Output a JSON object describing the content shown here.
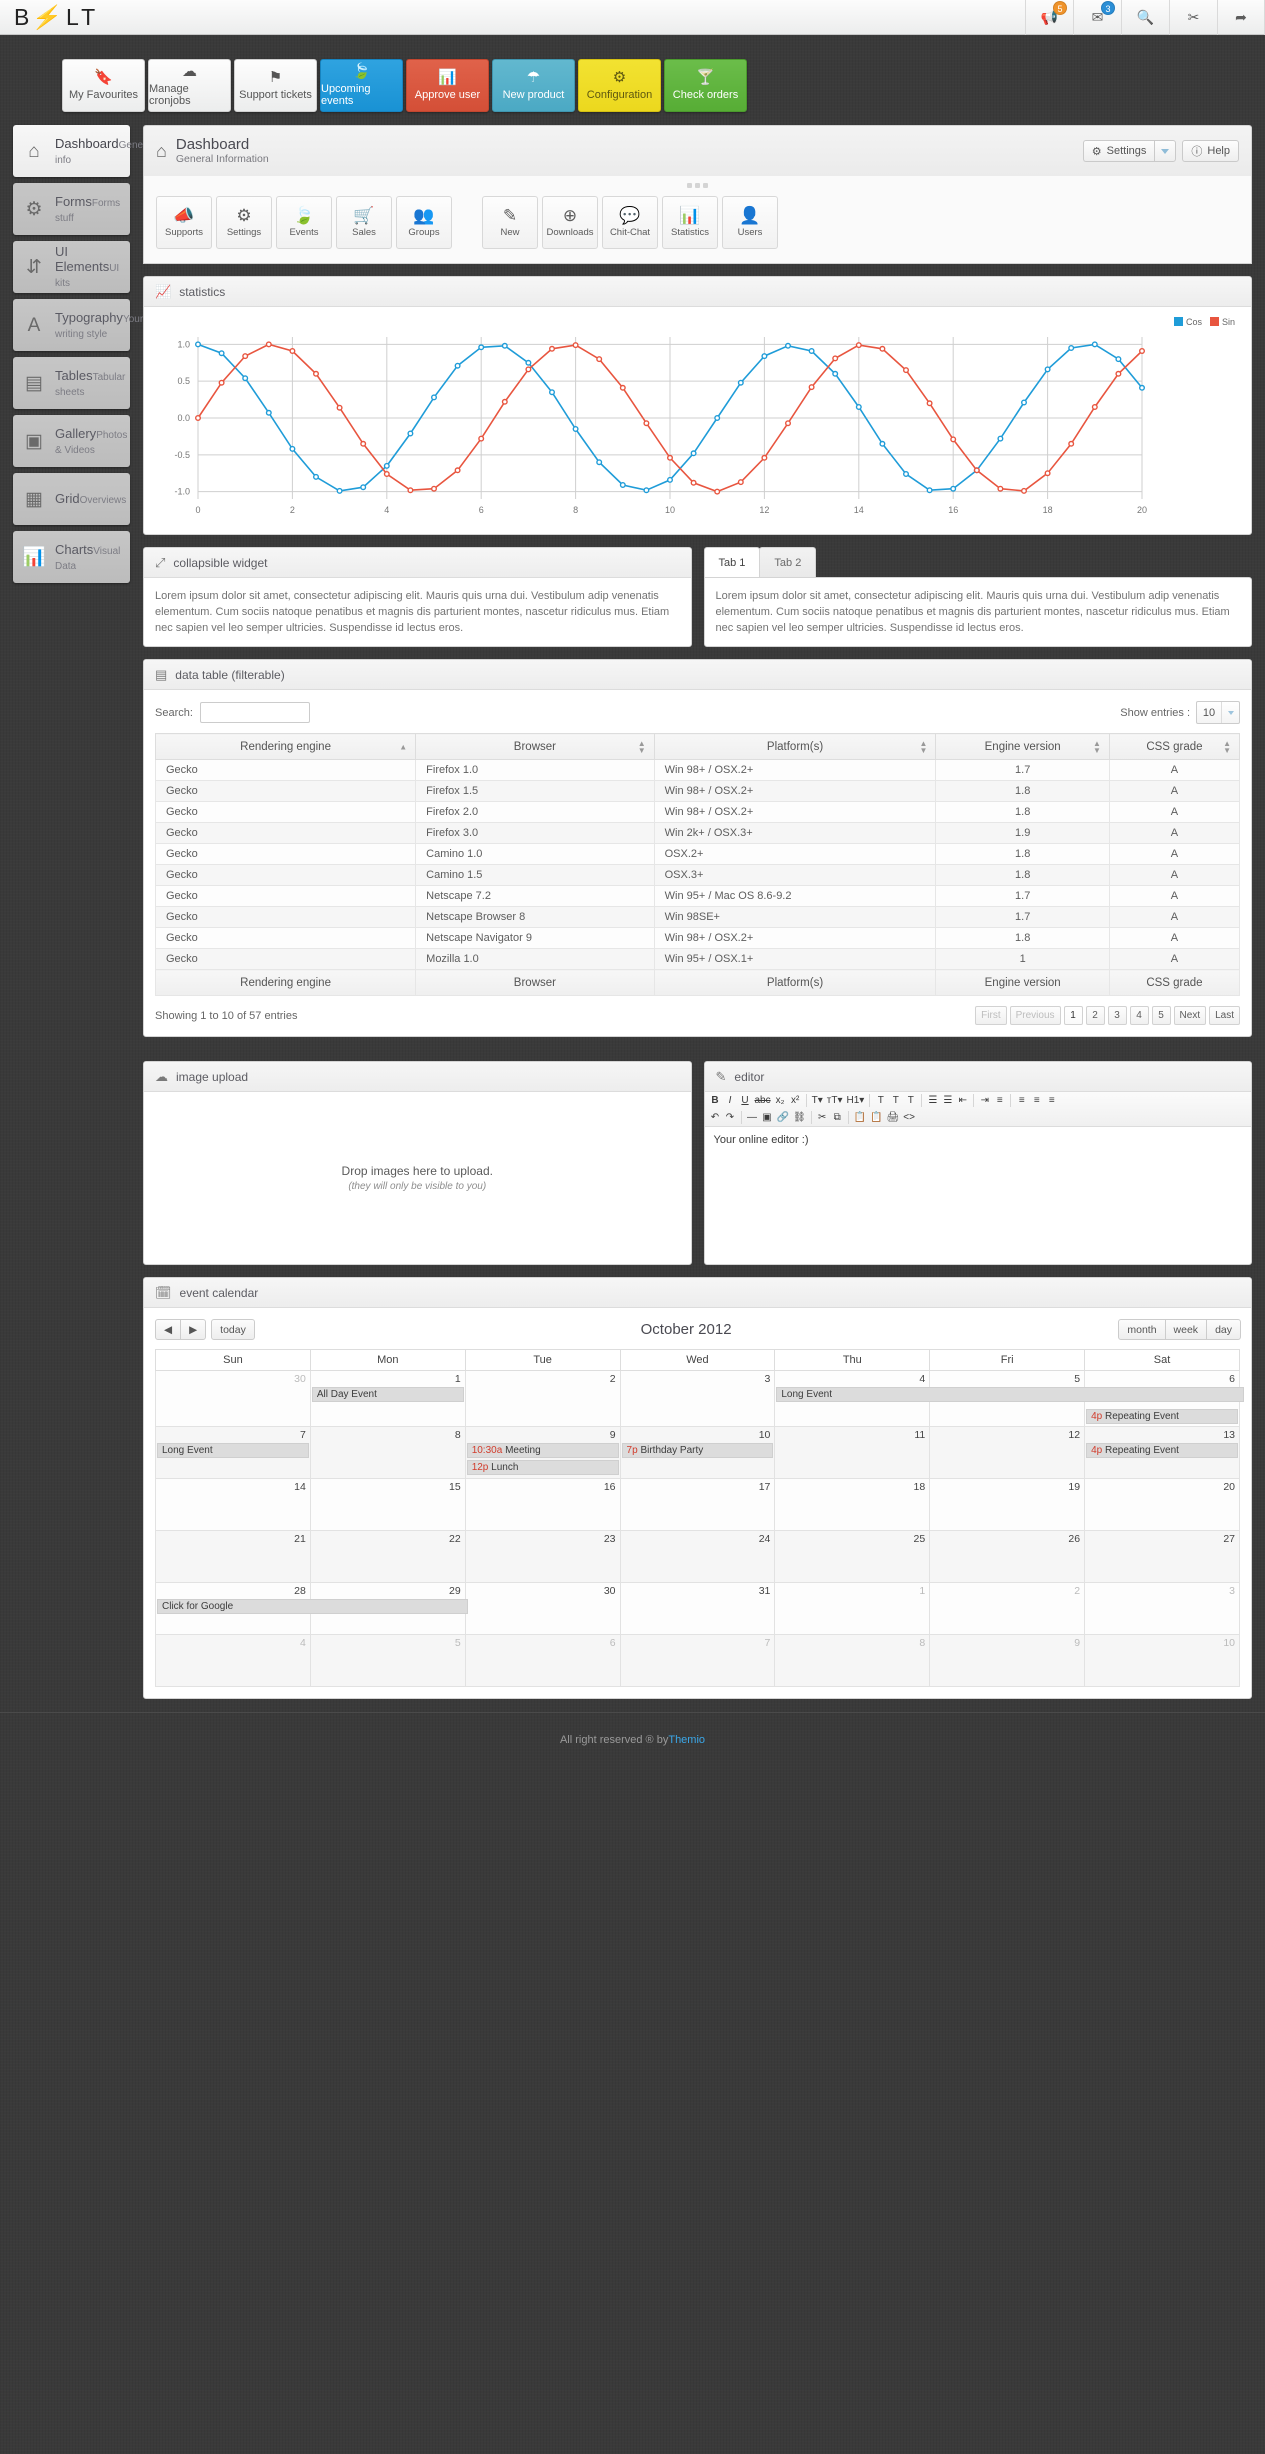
{
  "brand": {
    "before": "B",
    "bolt": "⚡",
    "after": "LT"
  },
  "topbar": {
    "icons": [
      {
        "name": "megaphone-icon",
        "glyph": "📢",
        "badge": "5",
        "badge_color": "#f0932a"
      },
      {
        "name": "envelope-icon",
        "glyph": "✉",
        "badge": "3",
        "badge_color": "#2a8ed6"
      },
      {
        "name": "search-icon",
        "glyph": "🔍",
        "badge": ""
      },
      {
        "name": "tools-icon",
        "glyph": "✂",
        "badge": ""
      },
      {
        "name": "share-icon",
        "glyph": "➦",
        "badge": ""
      }
    ]
  },
  "tiles": [
    {
      "label": "My Favourites",
      "icon": "bookmark-icon",
      "glyph": "🔖",
      "style": ""
    },
    {
      "label": "Manage cronjobs",
      "icon": "cloud-icon",
      "glyph": "☁",
      "style": ""
    },
    {
      "label": "Support tickets",
      "icon": "flag-icon",
      "glyph": "⚑",
      "style": ""
    },
    {
      "label": "Upcoming events",
      "icon": "leaf-icon",
      "glyph": "🍃",
      "style": "blue"
    },
    {
      "label": "Approve user",
      "icon": "chart-icon",
      "glyph": "📊",
      "style": "red"
    },
    {
      "label": "New product",
      "icon": "umbrella-icon",
      "glyph": "☂",
      "style": "teal"
    },
    {
      "label": "Configuration",
      "icon": "gears-icon",
      "glyph": "⚙",
      "style": "yellow"
    },
    {
      "label": "Check orders",
      "icon": "cocktail-icon",
      "glyph": "🍸",
      "style": "green"
    }
  ],
  "sidebar": {
    "items": [
      {
        "title": "Dashboard",
        "sub": "General info",
        "icon": "home-icon",
        "glyph": "⌂",
        "active": true
      },
      {
        "title": "Forms",
        "sub": "Forms stuff",
        "icon": "gear-icon",
        "glyph": "⚙",
        "active": false
      },
      {
        "title": "UI Elements",
        "sub": "UI kits",
        "icon": "sliders-icon",
        "glyph": "⇵",
        "active": false
      },
      {
        "title": "Typography",
        "sub": "Your writing style",
        "icon": "font-icon",
        "glyph": "A",
        "active": false
      },
      {
        "title": "Tables",
        "sub": "Tabular sheets",
        "icon": "table-icon",
        "glyph": "▤",
        "active": false
      },
      {
        "title": "Gallery",
        "sub": "Photos & Videos",
        "icon": "image-icon",
        "glyph": "▣",
        "active": false
      },
      {
        "title": "Grid",
        "sub": "Overviews",
        "icon": "grid-icon",
        "glyph": "▦",
        "active": false
      },
      {
        "title": "Charts",
        "sub": "Visual Data",
        "icon": "bar-chart-icon",
        "glyph": "📊",
        "active": false
      }
    ]
  },
  "page": {
    "title": "Dashboard",
    "subtitle": "General Information",
    "settings_label": "Settings",
    "help_label": "Help"
  },
  "shortcuts": [
    {
      "label": "Supports",
      "icon": "megaphone-icon",
      "glyph": "📣"
    },
    {
      "label": "Settings",
      "icon": "gear-icon",
      "glyph": "⚙"
    },
    {
      "label": "Events",
      "icon": "leaf-icon",
      "glyph": "🍃"
    },
    {
      "label": "Sales",
      "icon": "cart-icon",
      "glyph": "🛒"
    },
    {
      "label": "Groups",
      "icon": "group-icon",
      "glyph": "👥"
    },
    {
      "label": "New",
      "icon": "edit-icon",
      "glyph": "✎"
    },
    {
      "label": "Downloads",
      "icon": "download-icon",
      "glyph": "⊕"
    },
    {
      "label": "Chit-Chat",
      "icon": "comments-icon",
      "glyph": "💬"
    },
    {
      "label": "Statistics",
      "icon": "bar-chart-icon",
      "glyph": "📊"
    },
    {
      "label": "Users",
      "icon": "user-icon",
      "glyph": "👤"
    }
  ],
  "statistics": {
    "title": "statistics"
  },
  "chart_data": {
    "type": "line",
    "title": "statistics",
    "xlabel": "",
    "ylabel": "",
    "xlim": [
      0,
      20
    ],
    "ylim": [
      -1.1,
      1.1
    ],
    "xticks": [
      0,
      2,
      4,
      6,
      8,
      10,
      12,
      14,
      16,
      18,
      20
    ],
    "yticks": [
      -1.0,
      -0.5,
      0.0,
      0.5,
      1.0
    ],
    "grid": true,
    "legend_position": "top-right",
    "x": [
      0,
      0.5,
      1,
      1.5,
      2,
      2.5,
      3,
      3.5,
      4,
      4.5,
      5,
      5.5,
      6,
      6.5,
      7,
      7.5,
      8,
      8.5,
      9,
      9.5,
      10,
      10.5,
      11,
      11.5,
      12,
      12.5,
      13,
      13.5,
      14,
      14.5,
      15,
      15.5,
      16,
      16.5,
      17,
      17.5,
      18,
      18.5,
      19,
      19.5,
      20
    ],
    "series": [
      {
        "name": "Cos",
        "color": "#1f9cd8",
        "values": [
          1.0,
          0.88,
          0.54,
          0.07,
          -0.42,
          -0.8,
          -0.99,
          -0.94,
          -0.65,
          -0.21,
          0.28,
          0.71,
          0.96,
          0.98,
          0.75,
          0.35,
          -0.15,
          -0.6,
          -0.91,
          -0.98,
          -0.84,
          -0.48,
          0.0,
          0.48,
          0.84,
          0.98,
          0.91,
          0.6,
          0.15,
          -0.35,
          -0.76,
          -0.98,
          -0.96,
          -0.71,
          -0.28,
          0.21,
          0.66,
          0.95,
          1.0,
          0.8,
          0.41
        ]
      },
      {
        "name": "Sin",
        "color": "#e8553f",
        "values": [
          0.0,
          0.48,
          0.84,
          1.0,
          0.91,
          0.6,
          0.14,
          -0.35,
          -0.76,
          -0.98,
          -0.96,
          -0.71,
          -0.28,
          0.22,
          0.66,
          0.94,
          0.99,
          0.8,
          0.41,
          -0.07,
          -0.54,
          -0.88,
          -1.0,
          -0.87,
          -0.54,
          -0.07,
          0.42,
          0.81,
          0.99,
          0.94,
          0.65,
          0.2,
          -0.29,
          -0.71,
          -0.96,
          -0.99,
          -0.75,
          -0.35,
          0.15,
          0.6,
          0.91
        ]
      }
    ]
  },
  "collapsible": {
    "title": "collapsible widget",
    "body": "Lorem ipsum dolor sit amet, consectetur adipiscing elit. Mauris quis urna dui. Vestibulum adip venenatis elementum. Cum sociis natoque penatibus et magnis dis parturient montes, nascetur ridiculus mus. Etiam nec sapien vel leo semper ultricies. Suspendisse id lectus eros."
  },
  "tabs": {
    "items": [
      {
        "label": "Tab 1",
        "active": true
      },
      {
        "label": "Tab 2",
        "active": false
      }
    ],
    "body": "Lorem ipsum dolor sit amet, consectetur adipiscing elit. Mauris quis urna dui. Vestibulum adip venenatis elementum. Cum sociis natoque penatibus et magnis dis parturient montes, nascetur ridiculus mus. Etiam nec sapien vel leo semper ultricies. Suspendisse id lectus eros."
  },
  "datatable": {
    "title": "data table (filterable)",
    "search_label": "Search:",
    "search_value": "",
    "show_entries_label": "Show entries :",
    "entries_value": "10",
    "columns": [
      "Rendering engine",
      "Browser",
      "Platform(s)",
      "Engine version",
      "CSS grade"
    ],
    "rows": [
      [
        "Gecko",
        "Firefox 1.0",
        "Win 98+ / OSX.2+",
        "1.7",
        "A"
      ],
      [
        "Gecko",
        "Firefox 1.5",
        "Win 98+ / OSX.2+",
        "1.8",
        "A"
      ],
      [
        "Gecko",
        "Firefox 2.0",
        "Win 98+ / OSX.2+",
        "1.8",
        "A"
      ],
      [
        "Gecko",
        "Firefox 3.0",
        "Win 2k+ / OSX.3+",
        "1.9",
        "A"
      ],
      [
        "Gecko",
        "Camino 1.0",
        "OSX.2+",
        "1.8",
        "A"
      ],
      [
        "Gecko",
        "Camino 1.5",
        "OSX.3+",
        "1.8",
        "A"
      ],
      [
        "Gecko",
        "Netscape 7.2",
        "Win 95+ / Mac OS 8.6-9.2",
        "1.7",
        "A"
      ],
      [
        "Gecko",
        "Netscape Browser 8",
        "Win 98SE+",
        "1.7",
        "A"
      ],
      [
        "Gecko",
        "Netscape Navigator 9",
        "Win 98+ / OSX.2+",
        "1.8",
        "A"
      ],
      [
        "Gecko",
        "Mozilla 1.0",
        "Win 95+ / OSX.1+",
        "1",
        "A"
      ]
    ],
    "showing": "Showing 1 to 10 of 57 entries",
    "pager": [
      "First",
      "Previous",
      "1",
      "2",
      "3",
      "4",
      "5",
      "Next",
      "Last"
    ]
  },
  "upload": {
    "title": "image upload",
    "message": "Drop images here to upload.",
    "note": "(they will only be visible to you)"
  },
  "editor": {
    "title": "editor",
    "content": "Your online editor :)",
    "row1": [
      "B",
      "I",
      "U",
      "abc",
      "x₂",
      "x²",
      "T▾",
      "тT▾",
      "H1▾",
      "T",
      "T",
      "T",
      "☰",
      "☰",
      "⇤",
      "⇥",
      "≡",
      "≡",
      "≡",
      "≡"
    ],
    "row2": [
      "↶",
      "↷",
      "—",
      "▣",
      "🔗",
      "⛓",
      "✂",
      "⧉",
      "📋",
      "📋",
      "🖨",
      "<>"
    ]
  },
  "calendar": {
    "title": "event calendar",
    "month_title": "October 2012",
    "today_label": "today",
    "views": [
      "month",
      "week",
      "day"
    ],
    "daynames": [
      "Sun",
      "Mon",
      "Tue",
      "Wed",
      "Thu",
      "Fri",
      "Sat"
    ],
    "weeks": [
      [
        {
          "n": "30",
          "mut": true,
          "events": []
        },
        {
          "n": "1",
          "mut": false,
          "events": [
            {
              "time": "",
              "text": "All Day Event",
              "span": 1
            }
          ]
        },
        {
          "n": "2",
          "mut": false,
          "events": []
        },
        {
          "n": "3",
          "mut": false,
          "events": []
        },
        {
          "n": "4",
          "mut": false,
          "events": [
            {
              "time": "",
              "text": "Long Event",
              "span": 3
            }
          ]
        },
        {
          "n": "5",
          "mut": false,
          "events": []
        },
        {
          "n": "6",
          "mut": false,
          "events": [
            {
              "time": "4p",
              "text": "Repeating Event",
              "span": 1,
              "row": 2
            }
          ]
        }
      ],
      [
        {
          "n": "7",
          "mut": false,
          "events": [
            {
              "time": "",
              "text": "Long Event",
              "span": 1
            }
          ]
        },
        {
          "n": "8",
          "mut": false,
          "events": []
        },
        {
          "n": "9",
          "mut": false,
          "today": true,
          "events": [
            {
              "time": "10:30a",
              "text": "Meeting",
              "span": 1
            },
            {
              "time": "12p",
              "text": "Lunch",
              "span": 1
            }
          ]
        },
        {
          "n": "10",
          "mut": false,
          "events": [
            {
              "time": "7p",
              "text": "Birthday Party",
              "span": 1
            }
          ]
        },
        {
          "n": "11",
          "mut": false,
          "events": []
        },
        {
          "n": "12",
          "mut": false,
          "events": []
        },
        {
          "n": "13",
          "mut": false,
          "events": [
            {
              "time": "4p",
              "text": "Repeating Event",
              "span": 1
            }
          ]
        }
      ],
      [
        {
          "n": "14",
          "mut": false,
          "events": []
        },
        {
          "n": "15",
          "mut": false,
          "events": []
        },
        {
          "n": "16",
          "mut": false,
          "events": []
        },
        {
          "n": "17",
          "mut": false,
          "events": []
        },
        {
          "n": "18",
          "mut": false,
          "events": []
        },
        {
          "n": "19",
          "mut": false,
          "events": []
        },
        {
          "n": "20",
          "mut": false,
          "events": []
        }
      ],
      [
        {
          "n": "21",
          "mut": false,
          "events": []
        },
        {
          "n": "22",
          "mut": false,
          "events": []
        },
        {
          "n": "23",
          "mut": false,
          "events": []
        },
        {
          "n": "24",
          "mut": false,
          "events": []
        },
        {
          "n": "25",
          "mut": false,
          "events": []
        },
        {
          "n": "26",
          "mut": false,
          "events": []
        },
        {
          "n": "27",
          "mut": false,
          "events": []
        }
      ],
      [
        {
          "n": "28",
          "mut": false,
          "events": [
            {
              "time": "",
              "text": "Click for Google",
              "span": 2
            }
          ]
        },
        {
          "n": "29",
          "mut": false,
          "events": []
        },
        {
          "n": "30",
          "mut": false,
          "events": []
        },
        {
          "n": "31",
          "mut": false,
          "events": []
        },
        {
          "n": "1",
          "mut": true,
          "events": []
        },
        {
          "n": "2",
          "mut": true,
          "events": []
        },
        {
          "n": "3",
          "mut": true,
          "events": []
        }
      ],
      [
        {
          "n": "4",
          "mut": true,
          "events": []
        },
        {
          "n": "5",
          "mut": true,
          "events": []
        },
        {
          "n": "6",
          "mut": true,
          "events": []
        },
        {
          "n": "7",
          "mut": true,
          "events": []
        },
        {
          "n": "8",
          "mut": true,
          "events": []
        },
        {
          "n": "9",
          "mut": true,
          "events": []
        },
        {
          "n": "10",
          "mut": true,
          "events": []
        }
      ]
    ]
  },
  "footer": {
    "text": "All right reserved ® by ",
    "link": "Themio"
  }
}
